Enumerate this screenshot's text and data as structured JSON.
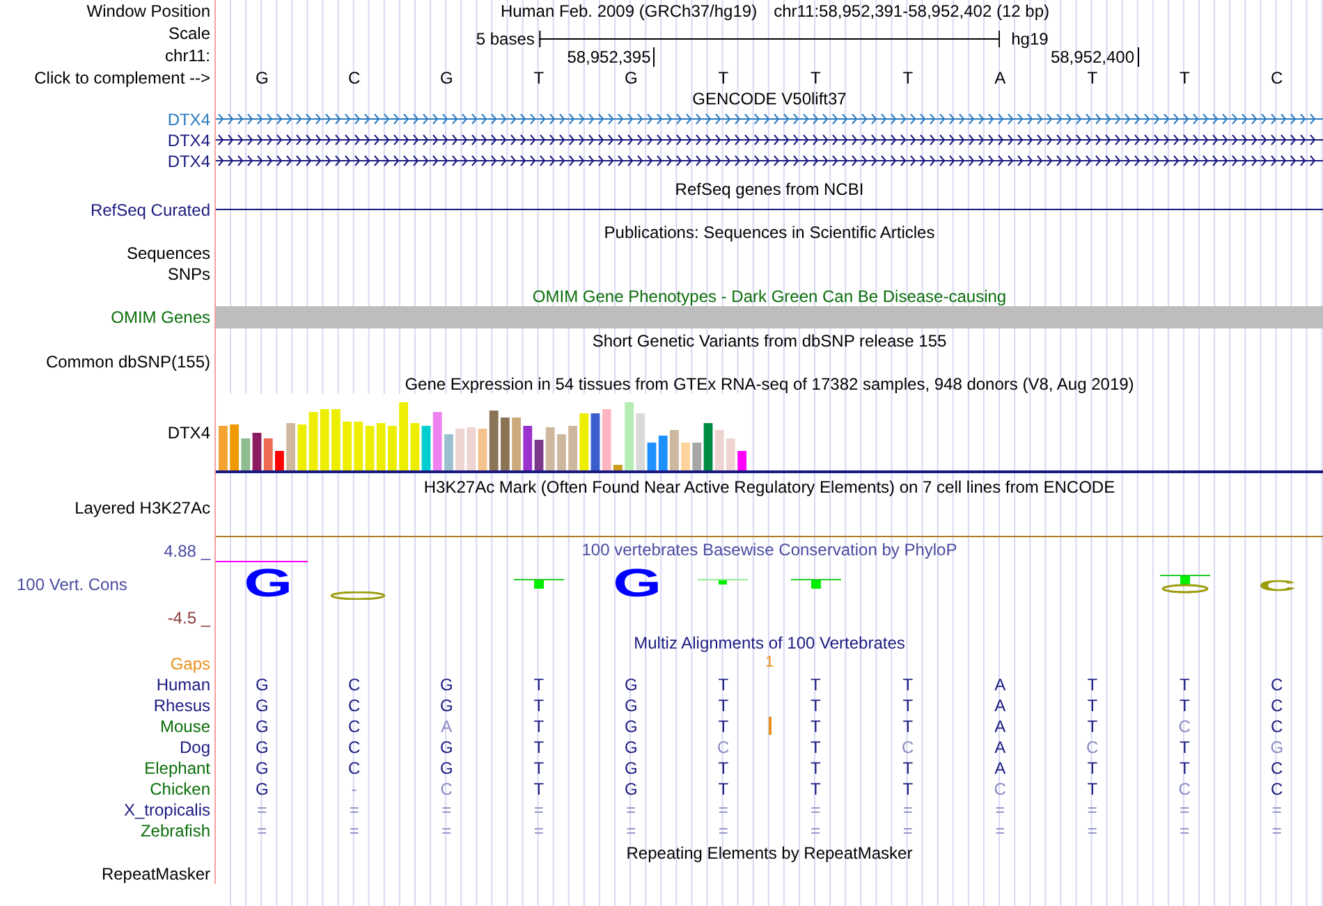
{
  "header": {
    "position_label": "Window Position",
    "assembly_title": "Human Feb. 2009 (GRCh37/hg19)",
    "range": "chr11:58,952,391-58,952,402 (12 bp)",
    "scale_label": "Scale",
    "scale_text": "5 bases",
    "assembly": "hg19",
    "chrom_label": "chr11:",
    "ticks": [
      "58,952,395",
      "58,952,400"
    ],
    "complement_label": "Click to complement -->",
    "bases": [
      "G",
      "C",
      "G",
      "T",
      "G",
      "T",
      "T",
      "T",
      "A",
      "T",
      "T",
      "C"
    ]
  },
  "tracks": [
    {
      "kind": "gene",
      "title": "GENCODE V50lift37",
      "items": [
        {
          "label": "DTX4",
          "color": "#2b7bc0",
          "kind": "arrows"
        },
        {
          "label": "DTX4",
          "color": "#1a1a80",
          "kind": "arrows"
        },
        {
          "label": "DTX4",
          "color": "#1a1a80",
          "kind": "arrows"
        }
      ]
    },
    {
      "kind": "gene",
      "title": "RefSeq genes from NCBI",
      "items": [
        {
          "label": "RefSeq Curated",
          "color": "#1a1a80",
          "kind": "plain"
        }
      ]
    },
    {
      "kind": "labels",
      "title": "Publications: Sequences in Scientific Articles",
      "labels": [
        "Sequences",
        "SNPs"
      ]
    },
    {
      "kind": "omim",
      "title": "OMIM Gene Phenotypes - Dark Green Can Be Disease-causing",
      "label": "OMIM Genes"
    },
    {
      "kind": "labels",
      "title": "Short Genetic Variants from dbSNP release 155",
      "labels": [
        "Common dbSNP(155)"
      ]
    },
    {
      "kind": "gtex",
      "title": "Gene Expression in 54 tissues from GTEx RNA-seq of 17382 samples, 948 donors (V8, Aug 2019)",
      "label": "DTX4"
    },
    {
      "kind": "h3k27",
      "title": "H3K27Ac Mark (Often Found Near Active Regulatory Elements) on 7 cell lines from ENCODE",
      "label": "Layered H3K27Ac"
    },
    {
      "kind": "phylop",
      "title": "100 vertebrates Basewise Conservation by PhyloP",
      "label": "100 Vert. Cons",
      "max": "4.88 _",
      "min": "-4.5 _",
      "logo": [
        {
          "kind": "big_letter",
          "base": "G",
          "marker": true
        },
        {
          "kind": "flat"
        },
        {
          "kind": "none"
        },
        {
          "kind": "tick"
        },
        {
          "kind": "big_letter",
          "base": "G",
          "marker": false
        },
        {
          "kind": "dot"
        },
        {
          "kind": "tick"
        },
        {
          "kind": "none"
        },
        {
          "kind": "none"
        },
        {
          "kind": "none"
        },
        {
          "kind": "tick_flat"
        },
        {
          "kind": "squashed_letter",
          "base": "C",
          "marker": false
        }
      ]
    },
    {
      "kind": "multiz",
      "title": "Multiz Alignments of 100 Vertebrates",
      "gaps_label": "Gaps",
      "gap_count": "1",
      "species": [
        {
          "name": "Human",
          "color": "#1a1a80",
          "insertion": false,
          "bases": [
            {
              "b": "G",
              "match": true
            },
            {
              "b": "C",
              "match": true
            },
            {
              "b": "G",
              "match": true
            },
            {
              "b": "T",
              "match": true
            },
            {
              "b": "G",
              "match": true
            },
            {
              "b": "T",
              "match": true
            },
            {
              "b": "T",
              "match": true
            },
            {
              "b": "T",
              "match": true
            },
            {
              "b": "A",
              "match": true
            },
            {
              "b": "T",
              "match": true
            },
            {
              "b": "T",
              "match": true
            },
            {
              "b": "C",
              "match": true
            }
          ]
        },
        {
          "name": "Rhesus",
          "color": "#1a1a80",
          "insertion": false,
          "bases": [
            {
              "b": "G",
              "match": true
            },
            {
              "b": "C",
              "match": true
            },
            {
              "b": "G",
              "match": true
            },
            {
              "b": "T",
              "match": true
            },
            {
              "b": "G",
              "match": true
            },
            {
              "b": "T",
              "match": true
            },
            {
              "b": "T",
              "match": true
            },
            {
              "b": "T",
              "match": true
            },
            {
              "b": "A",
              "match": true
            },
            {
              "b": "T",
              "match": true
            },
            {
              "b": "T",
              "match": true
            },
            {
              "b": "C",
              "match": true
            }
          ]
        },
        {
          "name": "Mouse",
          "color": "#0a6e0a",
          "insertion": true,
          "bases": [
            {
              "b": "G",
              "match": true
            },
            {
              "b": "C",
              "match": true
            },
            {
              "b": "A",
              "match": false
            },
            {
              "b": "T",
              "match": true
            },
            {
              "b": "G",
              "match": true
            },
            {
              "b": "T",
              "match": true
            },
            {
              "b": "T",
              "match": true
            },
            {
              "b": "T",
              "match": true
            },
            {
              "b": "A",
              "match": true
            },
            {
              "b": "T",
              "match": true
            },
            {
              "b": "C",
              "match": false
            },
            {
              "b": "C",
              "match": true
            }
          ]
        },
        {
          "name": "Dog",
          "color": "#1a1a80",
          "insertion": false,
          "bases": [
            {
              "b": "G",
              "match": true
            },
            {
              "b": "C",
              "match": true
            },
            {
              "b": "G",
              "match": true
            },
            {
              "b": "T",
              "match": true
            },
            {
              "b": "G",
              "match": true
            },
            {
              "b": "C",
              "match": false
            },
            {
              "b": "T",
              "match": true
            },
            {
              "b": "C",
              "match": false
            },
            {
              "b": "A",
              "match": true
            },
            {
              "b": "C",
              "match": false
            },
            {
              "b": "T",
              "match": true
            },
            {
              "b": "G",
              "match": false
            }
          ]
        },
        {
          "name": "Elephant",
          "color": "#0a6e0a",
          "insertion": false,
          "bases": [
            {
              "b": "G",
              "match": true
            },
            {
              "b": "C",
              "match": true
            },
            {
              "b": "G",
              "match": true
            },
            {
              "b": "T",
              "match": true
            },
            {
              "b": "G",
              "match": true
            },
            {
              "b": "T",
              "match": true
            },
            {
              "b": "T",
              "match": true
            },
            {
              "b": "T",
              "match": true
            },
            {
              "b": "A",
              "match": true
            },
            {
              "b": "T",
              "match": true
            },
            {
              "b": "T",
              "match": true
            },
            {
              "b": "C",
              "match": true
            }
          ]
        },
        {
          "name": "Chicken",
          "color": "#0a6e0a",
          "insertion": false,
          "bases": [
            {
              "b": "G",
              "match": true
            },
            {
              "b": "-",
              "match": false
            },
            {
              "b": "C",
              "match": false
            },
            {
              "b": "T",
              "match": true
            },
            {
              "b": "G",
              "match": true
            },
            {
              "b": "T",
              "match": true
            },
            {
              "b": "T",
              "match": true
            },
            {
              "b": "T",
              "match": true
            },
            {
              "b": "C",
              "match": false
            },
            {
              "b": "T",
              "match": true
            },
            {
              "b": "C",
              "match": false
            },
            {
              "b": "C",
              "match": true
            }
          ]
        },
        {
          "name": "X_tropicalis",
          "color": "#1a1a80",
          "insertion": false,
          "bases": [
            {
              "b": "=",
              "match": false
            },
            {
              "b": "=",
              "match": false
            },
            {
              "b": "=",
              "match": false
            },
            {
              "b": "=",
              "match": false
            },
            {
              "b": "=",
              "match": false
            },
            {
              "b": "=",
              "match": false
            },
            {
              "b": "=",
              "match": false
            },
            {
              "b": "=",
              "match": false
            },
            {
              "b": "=",
              "match": false
            },
            {
              "b": "=",
              "match": false
            },
            {
              "b": "=",
              "match": false
            },
            {
              "b": "=",
              "match": false
            }
          ]
        },
        {
          "name": "Zebrafish",
          "color": "#0a6e0a",
          "insertion": false,
          "bases": [
            {
              "b": "=",
              "match": false
            },
            {
              "b": "=",
              "match": false
            },
            {
              "b": "=",
              "match": false
            },
            {
              "b": "=",
              "match": false
            },
            {
              "b": "=",
              "match": false
            },
            {
              "b": "=",
              "match": false
            },
            {
              "b": "=",
              "match": false
            },
            {
              "b": "=",
              "match": false
            },
            {
              "b": "=",
              "match": false
            },
            {
              "b": "=",
              "match": false
            },
            {
              "b": "=",
              "match": false
            },
            {
              "b": "=",
              "match": false
            }
          ]
        }
      ]
    },
    {
      "kind": "labels",
      "title": "Repeating Elements by RepeatMasker",
      "labels": [
        "RepeatMasker"
      ]
    }
  ]
}
